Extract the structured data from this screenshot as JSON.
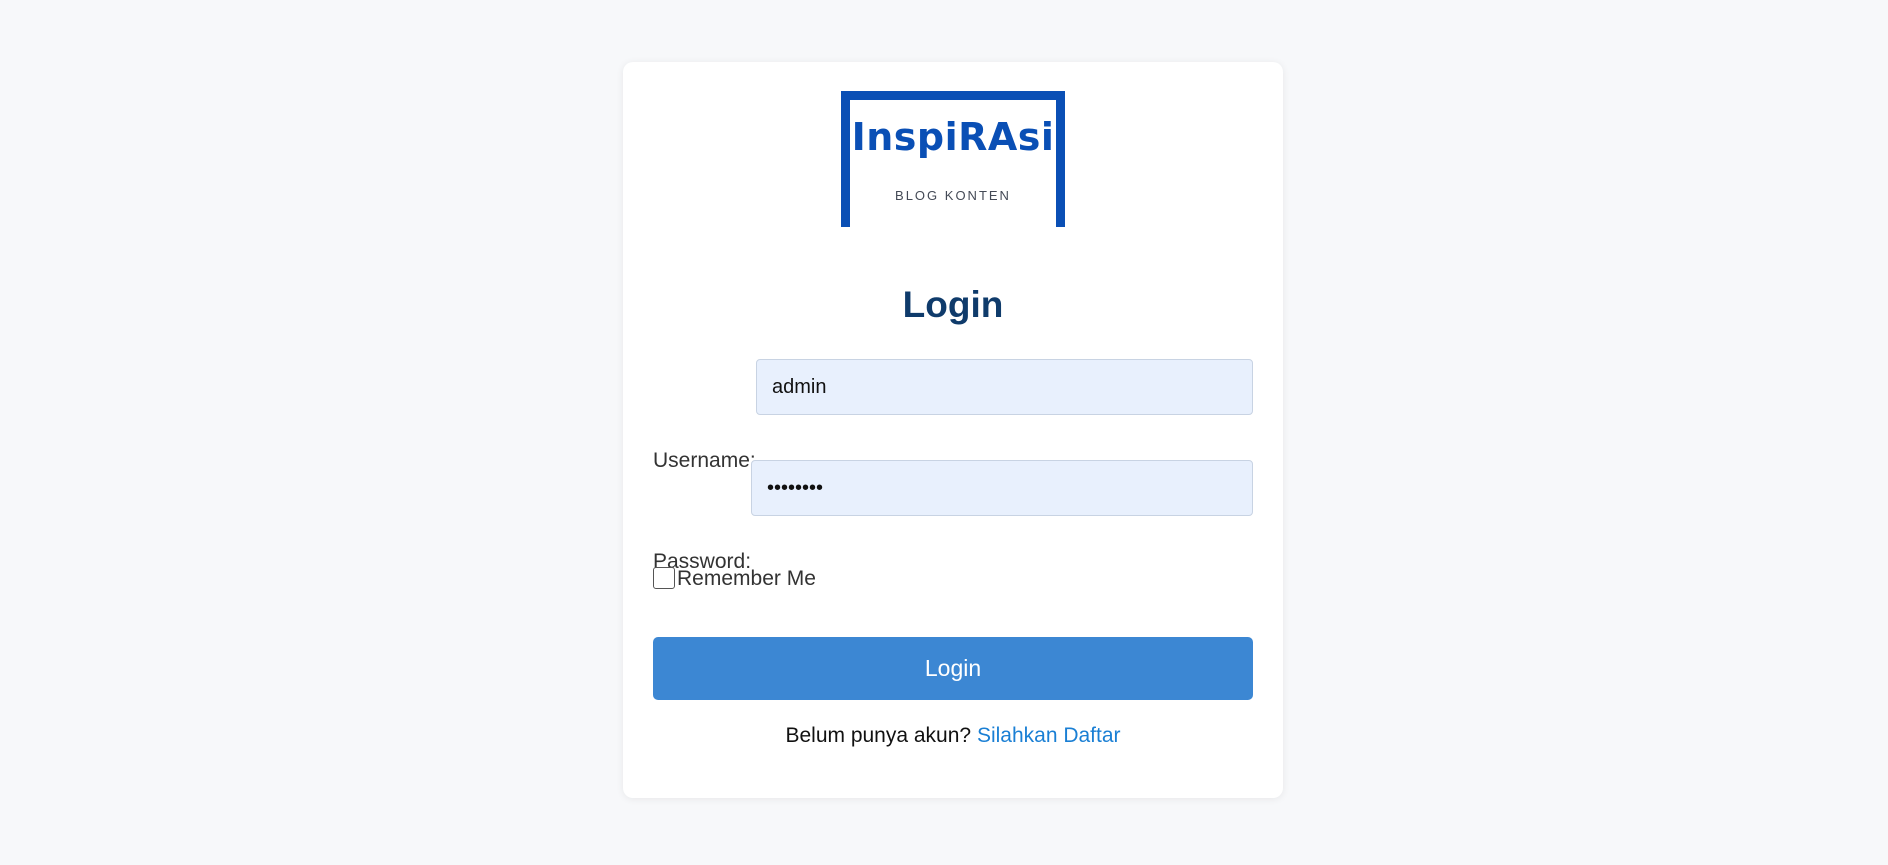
{
  "logo": {
    "title": "InspiRAsi",
    "subtitle": "BLOG KONTEN",
    "color": "#0a4fb5"
  },
  "form": {
    "heading": "Login",
    "username_label": "Username:",
    "username_value": "admin",
    "password_label": "Password:",
    "password_value": "password",
    "remember_label": "Remember Me",
    "remember_checked": false,
    "submit_label": "Login"
  },
  "footer": {
    "prompt": "Belum punya akun?",
    "link_label": "Silahkan Daftar"
  },
  "colors": {
    "background": "#f7f8fa",
    "heading": "#0f3b6b",
    "button": "#3c87d3",
    "link": "#1a7fd4",
    "input_bg": "#e8f0fd"
  }
}
